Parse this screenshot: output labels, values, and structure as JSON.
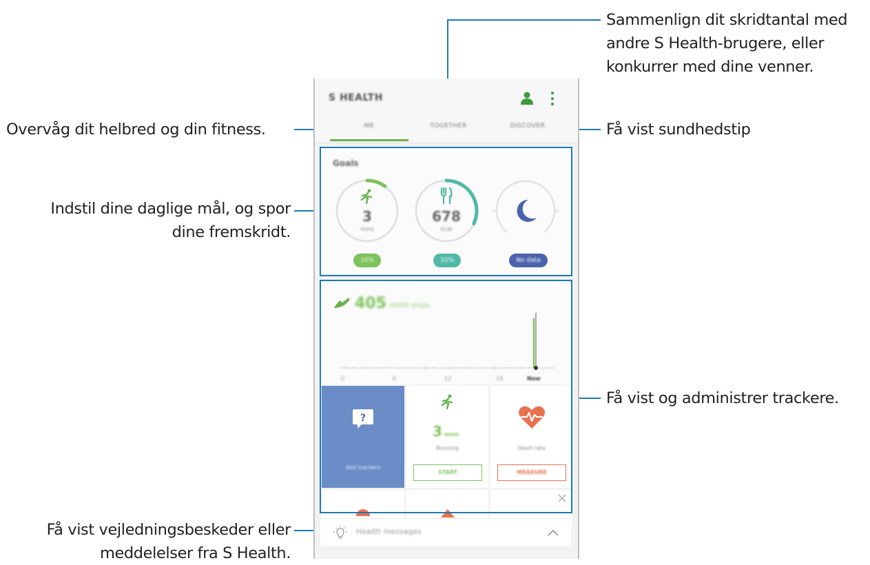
{
  "app": {
    "title": "S HEALTH",
    "tabs": [
      {
        "label": "ME",
        "selected": true
      },
      {
        "label": "TOGETHER",
        "selected": false
      },
      {
        "label": "DISCOVER",
        "selected": false
      }
    ]
  },
  "goals": {
    "title": "Goals",
    "items": [
      {
        "icon": "running-icon",
        "value": "3",
        "unit": "mins",
        "badge": "10%",
        "progress": 0.1,
        "color": "#7cc35a"
      },
      {
        "icon": "fork-knife-icon",
        "value": "678",
        "unit": "kcal",
        "badge": "32%",
        "progress": 0.32,
        "color": "#4fb9a6"
      },
      {
        "icon": "moon-icon",
        "value": "",
        "unit": "",
        "badge": "No data",
        "progress": 0,
        "color": "#4b62ad"
      }
    ]
  },
  "steps": {
    "value": "405",
    "unit": "/6000 steps",
    "axis_labels": [
      "0",
      "6",
      "12",
      "18",
      "Now"
    ]
  },
  "trackers": [
    {
      "label": "Add trackers",
      "icon": "question-bubble-icon"
    },
    {
      "value": "3",
      "unit": "mins",
      "label": "Running",
      "button": "START",
      "icon": "running-icon"
    },
    {
      "label": "Heart rate",
      "button": "MEASURE",
      "icon": "heart-rate-icon"
    }
  ],
  "messages": {
    "label": "Health messages"
  },
  "callouts": {
    "together": [
      "Sammenlign dit skridtantal med",
      "andre S Health-brugere, eller",
      "konkurrer med dine venner."
    ],
    "me": "Overvåg dit helbred og din fitness.",
    "discover": "Få vist sundhedstip",
    "goals": [
      "Indstil dine daglige mål, og spor",
      "dine fremskridt."
    ],
    "trackers": "Få vist og administrer trackere.",
    "messages": [
      "Få vist vejledningsbeskeder eller",
      "meddelelser fra S Health."
    ]
  },
  "colors": {
    "accent": "#1a7ab5",
    "green": "#7cc35a",
    "teal": "#4fb9a6",
    "navy": "#4b62ad",
    "orange": "#e8714f",
    "tile_blue": "#6a8cc7"
  }
}
